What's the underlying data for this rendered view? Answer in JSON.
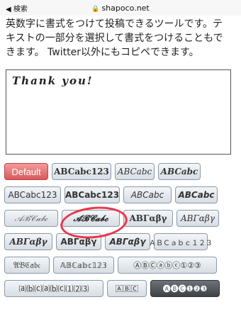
{
  "status_bar": {
    "back_label": "◀ 検索",
    "url": "shapoco.net"
  },
  "description": {
    "line1": "英数字に書式をつけて投稿できるツールです。テ",
    "line2": "キストの一部分を選択して書式をつけることもで",
    "line3": "きます。 Twitter以外にもコピペできます。"
  },
  "textarea": {
    "value": "Thank you!"
  },
  "rows": [
    [
      "Default",
      "ABCabc123",
      "ABCabc",
      "ABCabc"
    ],
    [
      "ABCabc123",
      "ABCabc123",
      "ABCabc",
      "ABCabc"
    ],
    [
      "𝒜ℬ𝒞𝒶𝒷𝒸",
      "𝓐𝓑𝓒𝓪𝓫𝓬",
      "ΑΒΓαβγ",
      "ΑΒΓαβγ"
    ],
    [
      "ΑΒΓαβγ",
      "ΑΒΓαβγ",
      "ΑΒΓαβγ",
      "ＡＢＣａｂｃ１２３"
    ],
    [
      "𝔄𝔅ℭ𝔞𝔟𝔠",
      "𝔸𝔹ℂ𝕒𝕓𝕔𝟙𝟚𝟛",
      "ⒶⒷⒸⓐⓑⓒ①②③"
    ],
    [
      "⒜⒝⒞⒜⒝⒞⑴⑵⑶",
      "🄰🄱🄲",
      "🅐🅑🅒❶❷❸"
    ]
  ]
}
